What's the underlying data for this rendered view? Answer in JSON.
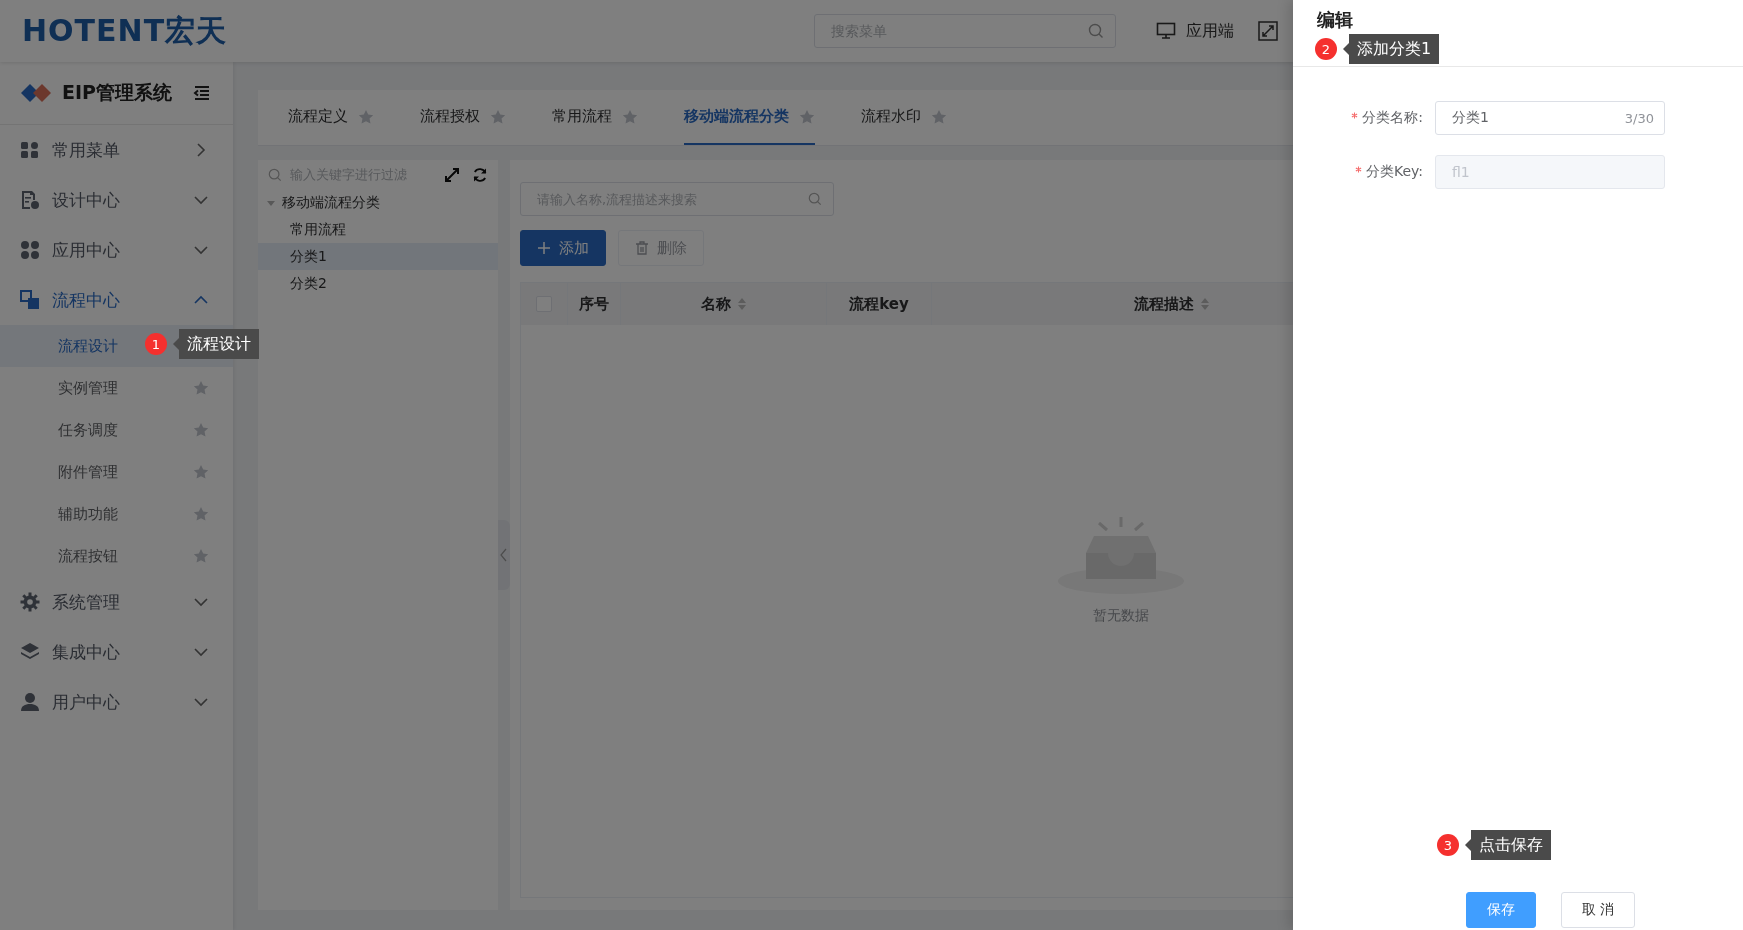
{
  "header": {
    "logo": "HOTENT宏天",
    "search": {
      "placeholder": "搜索菜单"
    },
    "actions": [
      {
        "label": "应用端"
      }
    ]
  },
  "sidebar": {
    "title": "EIP管理系统",
    "menu": [
      {
        "label": "常用菜单",
        "kind": "page",
        "selected": false
      },
      {
        "label": "设计中心",
        "kind": "group",
        "selected": false,
        "expanded": false
      },
      {
        "label": "应用中心",
        "kind": "group",
        "selected": false,
        "expanded": false
      },
      {
        "label": "流程中心",
        "kind": "group",
        "selected": true,
        "expanded": true,
        "children": [
          {
            "label": "流程设计",
            "selected": true,
            "guide": {
              "step": "1",
              "text": "流程设计"
            }
          },
          {
            "label": "实例管理",
            "selected": false
          },
          {
            "label": "任务调度",
            "selected": false
          },
          {
            "label": "附件管理",
            "selected": false
          },
          {
            "label": "辅助功能",
            "selected": false
          },
          {
            "label": "流程按钮",
            "selected": false
          }
        ]
      },
      {
        "label": "系统管理",
        "kind": "group",
        "selected": false,
        "expanded": false
      },
      {
        "label": "集成中心",
        "kind": "group",
        "selected": false,
        "expanded": false
      },
      {
        "label": "用户中心",
        "kind": "group",
        "selected": false,
        "expanded": false
      }
    ]
  },
  "tabs": [
    {
      "label": "流程定义",
      "selected": false
    },
    {
      "label": "流程授权",
      "selected": false
    },
    {
      "label": "常用流程",
      "selected": false
    },
    {
      "label": "移动端流程分类",
      "selected": true
    },
    {
      "label": "流程水印",
      "selected": false
    }
  ],
  "tree": {
    "filter": {
      "placeholder": "输入关键字进行过滤"
    },
    "nodes": [
      {
        "label": "移动端流程分类",
        "expanded": true,
        "selected": false,
        "children": [
          {
            "label": "常用流程",
            "selected": false
          },
          {
            "label": "分类1",
            "selected": true
          },
          {
            "label": "分类2",
            "selected": false
          }
        ]
      }
    ]
  },
  "list": {
    "search": {
      "placeholder": "请输入名称,流程描述来搜索"
    },
    "buttons": [
      {
        "label": "添加",
        "kind": "add",
        "disabled": false
      },
      {
        "label": "删除",
        "kind": "delete",
        "disabled": true
      }
    ],
    "table": {
      "select_all": {
        "checked": false
      },
      "columns": [
        {
          "label": "序号",
          "sortable": false
        },
        {
          "label": "名称",
          "sortable": true
        },
        {
          "label": "流程key",
          "sortable": false
        },
        {
          "label": "流程描述",
          "sortable": true
        }
      ],
      "empty_text": "暂无数据"
    }
  },
  "drawer": {
    "title": "编辑",
    "guide": {
      "step": "2",
      "text": "添加分类1"
    },
    "fields": [
      {
        "label": "分类名称:",
        "required": true,
        "value": "分类1",
        "counter": "3/30",
        "disabled": false
      },
      {
        "label": "分类Key:",
        "required": true,
        "value": "fl1",
        "disabled": true
      }
    ],
    "footer_guide": {
      "step": "3",
      "text": "点击保存"
    },
    "buttons": [
      {
        "label": "保存",
        "kind": "primary"
      },
      {
        "label": "取 消",
        "kind": "default"
      }
    ]
  }
}
